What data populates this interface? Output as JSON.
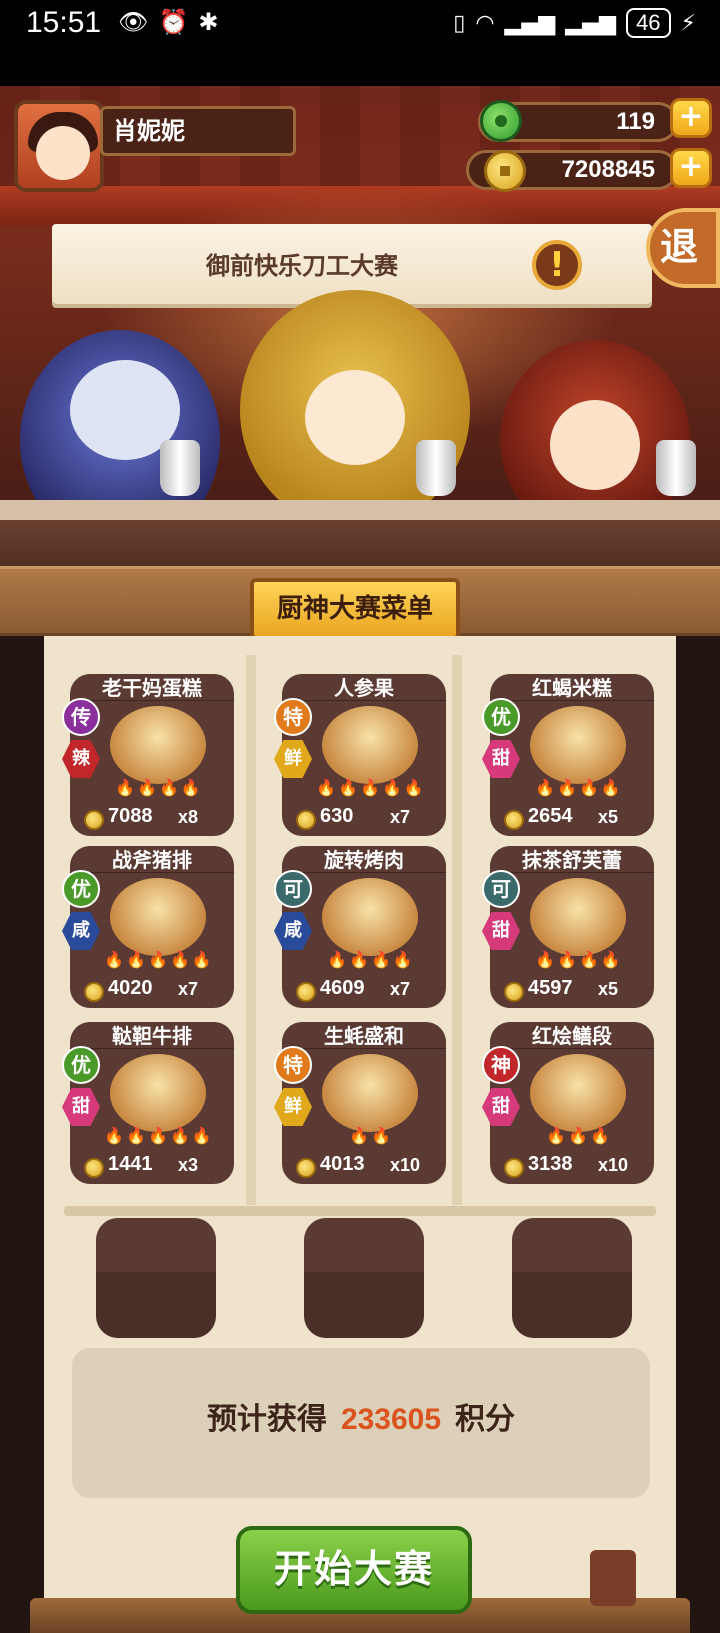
{
  "status_bar": {
    "time": "15:51",
    "battery": "46"
  },
  "player": {
    "name": "肖妮妮"
  },
  "resources": {
    "jade": "119",
    "coins": "7208845",
    "add_label": "+"
  },
  "event": {
    "title": "御前快乐刀工大赛",
    "alert": "!",
    "exit_label": "退"
  },
  "menu": {
    "title": "厨神大赛菜单",
    "dishes": [
      {
        "name": "老干妈蛋糕",
        "rank": "传",
        "rank_color": "#8a2f9c",
        "taste": "辣",
        "taste_color": "#c0262a",
        "price": "7088",
        "qty": "x8",
        "flames": 4
      },
      {
        "name": "人参果",
        "rank": "特",
        "rank_color": "#e07a1a",
        "taste": "鲜",
        "taste_color": "#e0a81a",
        "price": "630",
        "qty": "x7",
        "flames": 5
      },
      {
        "name": "红蝎米糕",
        "rank": "优",
        "rank_color": "#4a9a2a",
        "taste": "甜",
        "taste_color": "#d63a7a",
        "price": "2654",
        "qty": "x5",
        "flames": 4
      },
      {
        "name": "战斧猪排",
        "rank": "优",
        "rank_color": "#4a9a2a",
        "taste": "咸",
        "taste_color": "#2a4a9c",
        "price": "4020",
        "qty": "x7",
        "flames": 5
      },
      {
        "name": "旋转烤肉",
        "rank": "可",
        "rank_color": "#3a6a6a",
        "taste": "咸",
        "taste_color": "#2a4a9c",
        "price": "4609",
        "qty": "x7",
        "flames": 4
      },
      {
        "name": "抹茶舒芙蕾",
        "rank": "可",
        "rank_color": "#3a6a6a",
        "taste": "甜",
        "taste_color": "#d63a7a",
        "price": "4597",
        "qty": "x5",
        "flames": 4
      },
      {
        "name": "鞑靼牛排",
        "rank": "优",
        "rank_color": "#4a9a2a",
        "taste": "甜",
        "taste_color": "#d63a7a",
        "price": "1441",
        "qty": "x3",
        "flames": 5
      },
      {
        "name": "生蚝盛和",
        "rank": "特",
        "rank_color": "#e07a1a",
        "taste": "鲜",
        "taste_color": "#e0a81a",
        "price": "4013",
        "qty": "x10",
        "flames": 2
      },
      {
        "name": "红烩鳝段",
        "rank": "神",
        "rank_color": "#c0262a",
        "taste": "甜",
        "taste_color": "#d63a7a",
        "price": "3138",
        "qty": "x10",
        "flames": 3
      }
    ]
  },
  "estimate": {
    "prefix": "预计获得",
    "value": "233605",
    "suffix": "积分"
  },
  "actions": {
    "start_label": "开始大赛"
  }
}
